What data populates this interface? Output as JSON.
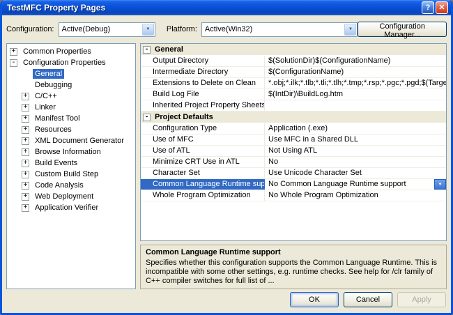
{
  "window": {
    "title": "TestMFC Property Pages",
    "help_glyph": "?",
    "close_glyph": "✕"
  },
  "toolbar": {
    "configuration_label": "Configuration:",
    "configuration_value": "Active(Debug)",
    "platform_label": "Platform:",
    "platform_value": "Active(Win32)",
    "config_manager_label": "Configuration Manager..."
  },
  "tree": {
    "items": [
      {
        "label": "Common Properties",
        "state": "collapsed",
        "level": 0,
        "selected": false
      },
      {
        "label": "Configuration Properties",
        "state": "expanded",
        "level": 0,
        "selected": false
      },
      {
        "label": "General",
        "state": "leaf",
        "level": 1,
        "selected": true
      },
      {
        "label": "Debugging",
        "state": "leaf",
        "level": 1,
        "selected": false
      },
      {
        "label": "C/C++",
        "state": "collapsed",
        "level": 1,
        "selected": false
      },
      {
        "label": "Linker",
        "state": "collapsed",
        "level": 1,
        "selected": false
      },
      {
        "label": "Manifest Tool",
        "state": "collapsed",
        "level": 1,
        "selected": false
      },
      {
        "label": "Resources",
        "state": "collapsed",
        "level": 1,
        "selected": false
      },
      {
        "label": "XML Document Generator",
        "state": "collapsed",
        "level": 1,
        "selected": false
      },
      {
        "label": "Browse Information",
        "state": "collapsed",
        "level": 1,
        "selected": false
      },
      {
        "label": "Build Events",
        "state": "collapsed",
        "level": 1,
        "selected": false
      },
      {
        "label": "Custom Build Step",
        "state": "collapsed",
        "level": 1,
        "selected": false
      },
      {
        "label": "Code Analysis",
        "state": "collapsed",
        "level": 1,
        "selected": false
      },
      {
        "label": "Web Deployment",
        "state": "collapsed",
        "level": 1,
        "selected": false
      },
      {
        "label": "Application Verifier",
        "state": "collapsed",
        "level": 1,
        "selected": false
      }
    ]
  },
  "property_grid": {
    "sections": [
      {
        "title": "General",
        "rows": [
          {
            "name": "Output Directory",
            "value": "$(SolutionDir)$(ConfigurationName)",
            "selected": false
          },
          {
            "name": "Intermediate Directory",
            "value": "$(ConfigurationName)",
            "selected": false
          },
          {
            "name": "Extensions to Delete on Clean",
            "value": "*.obj;*.ilk;*.tlb;*.tli;*.tlh;*.tmp;*.rsp;*.pgc;*.pgd;$(TargetF",
            "selected": false
          },
          {
            "name": "Build Log File",
            "value": "$(IntDir)\\BuildLog.htm",
            "selected": false
          },
          {
            "name": "Inherited Project Property Sheets",
            "value": "",
            "selected": false
          }
        ]
      },
      {
        "title": "Project Defaults",
        "rows": [
          {
            "name": "Configuration Type",
            "value": "Application (.exe)",
            "selected": false
          },
          {
            "name": "Use of MFC",
            "value": "Use MFC in a Shared DLL",
            "selected": false
          },
          {
            "name": "Use of ATL",
            "value": "Not Using ATL",
            "selected": false
          },
          {
            "name": "Minimize CRT Use in ATL",
            "value": "No",
            "selected": false
          },
          {
            "name": "Character Set",
            "value": "Use Unicode Character Set",
            "selected": false
          },
          {
            "name": "Common Language Runtime support",
            "value": "No Common Language Runtime support",
            "selected": true
          },
          {
            "name": "Whole Program Optimization",
            "value": "No Whole Program Optimization",
            "selected": false
          }
        ]
      }
    ]
  },
  "description": {
    "title": "Common Language Runtime support",
    "text": "Specifies whether this configuration supports the Common Language Runtime.  This is incompatible with some other settings, e.g. runtime checks. See help for /clr family of C++ compiler switches for full list of ..."
  },
  "footer": {
    "ok_label": "OK",
    "cancel_label": "Cancel",
    "apply_label": "Apply"
  },
  "colors": {
    "selection": "#316AC5",
    "dialog_background": "#ECE9D8",
    "titlebar_blue": "#0B50D8",
    "control_border": "#7F9DB9"
  }
}
